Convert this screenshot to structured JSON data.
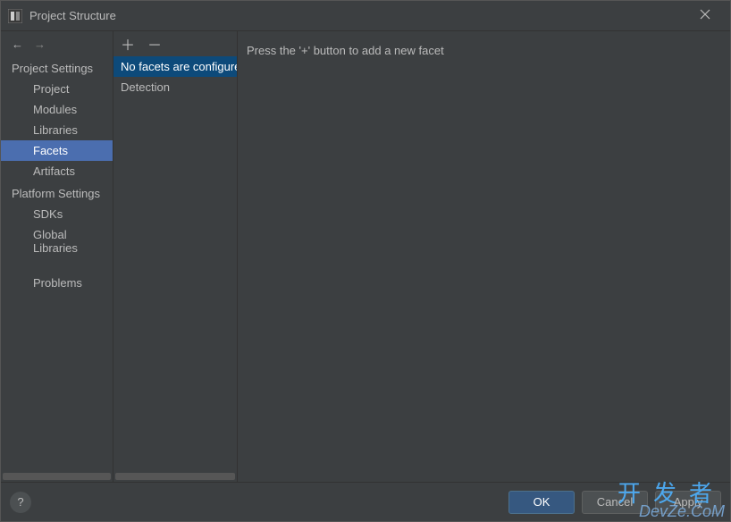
{
  "window": {
    "title": "Project Structure"
  },
  "sidebar": {
    "sections": {
      "project_settings": {
        "header": "Project Settings",
        "items": [
          "Project",
          "Modules",
          "Libraries",
          "Facets",
          "Artifacts"
        ],
        "selected_index": 3
      },
      "platform_settings": {
        "header": "Platform Settings",
        "items": [
          "SDKs",
          "Global Libraries"
        ]
      },
      "problems": {
        "item": "Problems"
      }
    }
  },
  "middle": {
    "rows": [
      "No facets are configured",
      "Detection"
    ],
    "highlight_index": 0
  },
  "content": {
    "message": "Press the '+' button to add a new facet"
  },
  "footer": {
    "ok": "OK",
    "cancel": "Cancel",
    "apply": "Apply",
    "help": "?"
  },
  "watermark": {
    "line1": "开发者",
    "line2": "DevZe.CoM"
  }
}
